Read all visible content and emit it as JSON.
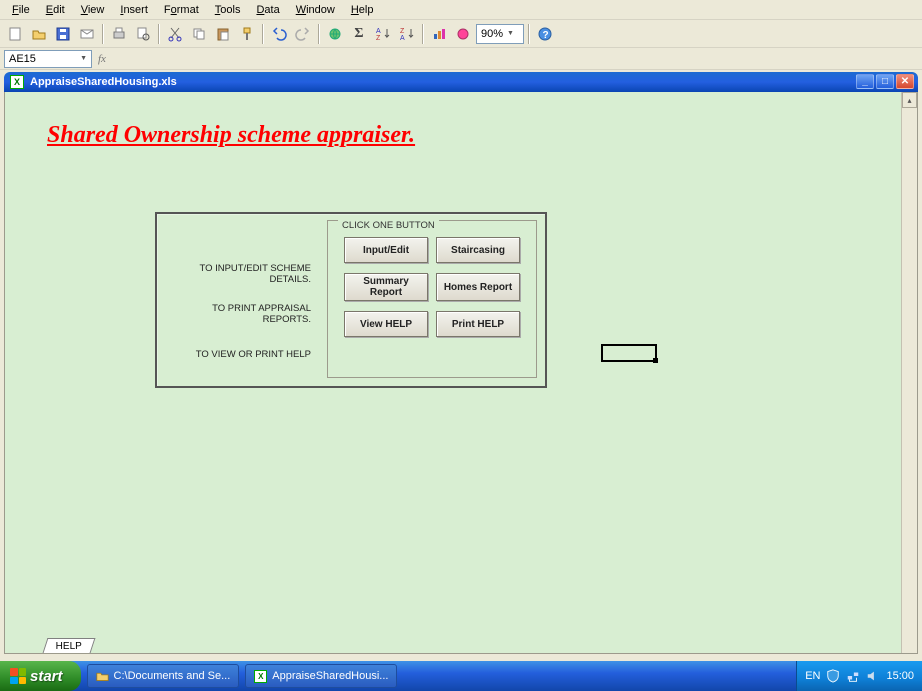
{
  "menu": {
    "items": [
      "File",
      "Edit",
      "View",
      "Insert",
      "Format",
      "Tools",
      "Data",
      "Window",
      "Help"
    ]
  },
  "toolbar": {
    "zoom": "90%"
  },
  "formula_bar": {
    "name_box": "AE15",
    "fx_label": "fx"
  },
  "doc_window": {
    "title": "AppraiseSharedHousing.xls"
  },
  "sheet": {
    "heading": "Shared Ownership scheme appraiser.",
    "left_labels": {
      "l0": "TO INPUT/EDIT SCHEME DETAILS.",
      "l1": "TO PRINT APPRAISAL REPORTS.",
      "l2": "TO VIEW OR PRINT HELP"
    },
    "group_legend": "CLICK ONE BUTTON",
    "buttons": {
      "b0": "Input/Edit",
      "b1": "Staircasing",
      "b2": "Summary Report",
      "b3": "Homes Report",
      "b4": "View HELP",
      "b5": "Print HELP"
    },
    "tab": "HELP"
  },
  "taskbar": {
    "start": "start",
    "item0": "C:\\Documents and Se...",
    "item1": "AppraiseSharedHousi...",
    "lang": "EN",
    "clock": "15:00"
  }
}
